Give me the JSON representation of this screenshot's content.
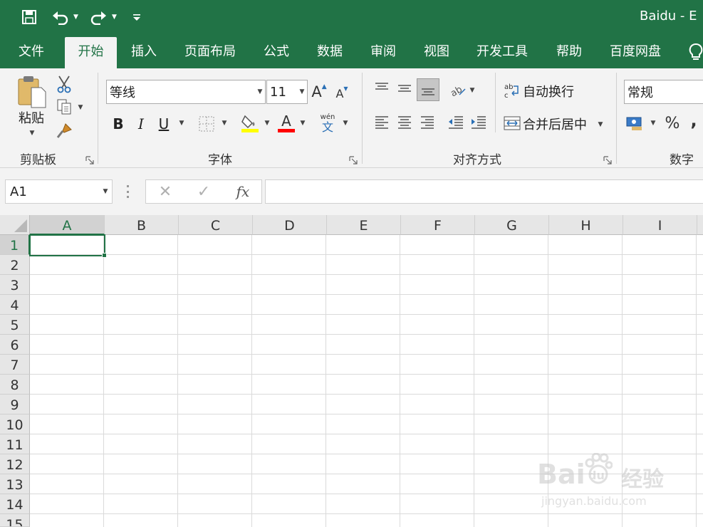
{
  "titlebar": {
    "title": "Baidu  -  E",
    "save_icon": "save-icon",
    "undo_icon": "undo-icon",
    "redo_icon": "redo-icon",
    "qat_icon": "customize-qat-icon"
  },
  "tabs": [
    {
      "label": "文件"
    },
    {
      "label": "开始"
    },
    {
      "label": "插入"
    },
    {
      "label": "页面布局"
    },
    {
      "label": "公式"
    },
    {
      "label": "数据"
    },
    {
      "label": "审阅"
    },
    {
      "label": "视图"
    },
    {
      "label": "开发工具"
    },
    {
      "label": "帮助"
    },
    {
      "label": "百度网盘"
    }
  ],
  "active_tab": "开始",
  "ribbon": {
    "clipboard": {
      "paste_label": "粘贴",
      "group_label": "剪贴板"
    },
    "font": {
      "font_name": "等线",
      "font_size": "11",
      "bold": "B",
      "italic": "I",
      "underline": "U",
      "font_color_glyph": "A",
      "grow_glyph": "A",
      "shrink_glyph": "A",
      "phonetic_top": "wén",
      "phonetic_bottom": "文",
      "group_label": "字体"
    },
    "alignment": {
      "wrap_label": "自动换行",
      "merge_label": "合并后居中",
      "group_label": "对齐方式"
    },
    "number": {
      "format": "常规",
      "percent": "%",
      "comma": ",",
      "group_label": "数字"
    }
  },
  "formula_bar": {
    "name_box": "A1",
    "cancel": "✕",
    "enter": "✓",
    "fx": "fx",
    "value": ""
  },
  "grid": {
    "columns": [
      "A",
      "B",
      "C",
      "D",
      "E",
      "F",
      "G",
      "H",
      "I"
    ],
    "rows": [
      "1",
      "2",
      "3",
      "4",
      "5",
      "6",
      "7",
      "8",
      "9",
      "10",
      "11",
      "12",
      "13",
      "14",
      "15"
    ],
    "selected_cell": "A1"
  },
  "watermark": {
    "brand": "Bai",
    "brand2": "du",
    "suffix": "经验",
    "url": "jingyan.baidu.com"
  },
  "colors": {
    "accent": "#217346",
    "ribbon_bg": "#f3f3f3",
    "fill_yellow": "#ffff00",
    "font_red": "#ff0000"
  }
}
